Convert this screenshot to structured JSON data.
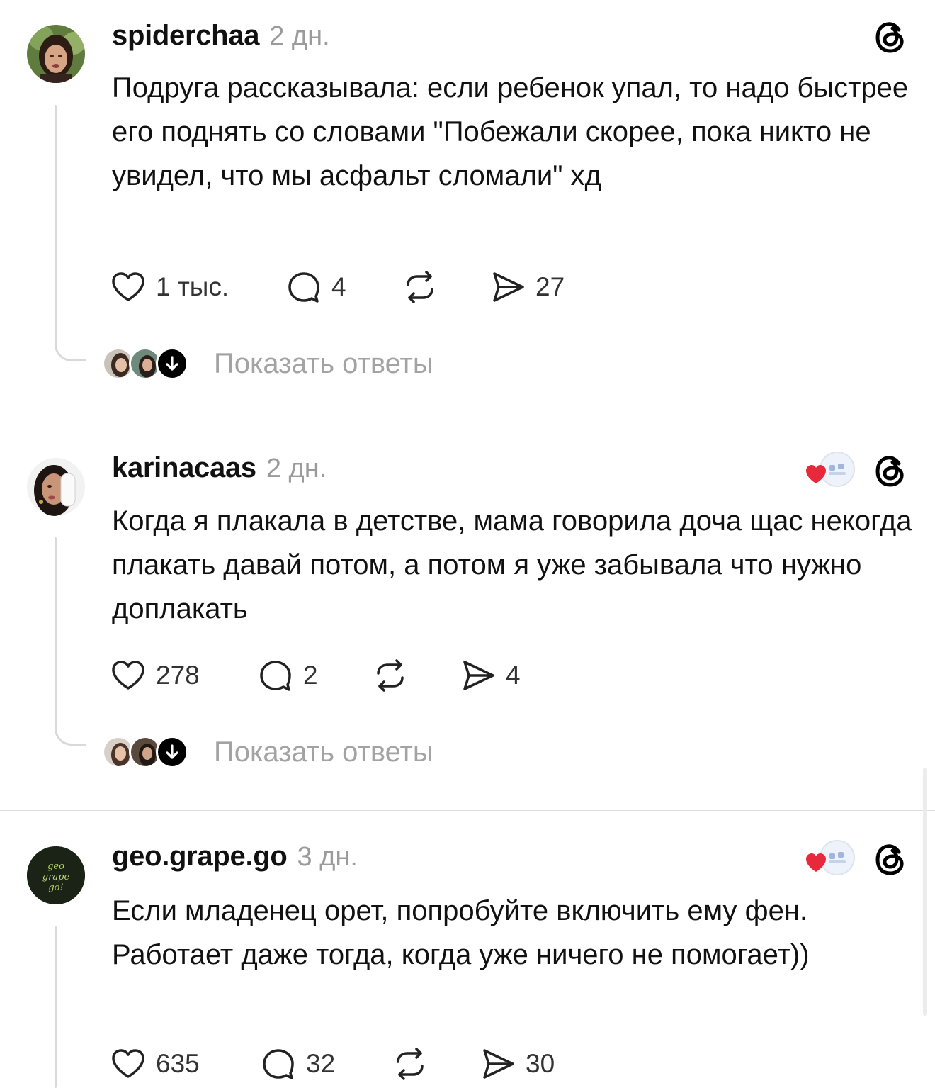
{
  "posts": [
    {
      "username": "spiderchaa",
      "time": "2 дн.",
      "text": "Подруга рассказывала: если ребенок упал, то надо быстрее его поднять со словами \"Побежали скорее, пока никто не увидел, что мы асфальт сломали\" хд",
      "likes": "1 тыс.",
      "comments": "4",
      "shares": "27",
      "show_replies": "Показать ответы",
      "has_reaction": false
    },
    {
      "username": "karinacaas",
      "time": "2 дн.",
      "text": "Когда я плакала в детстве, мама говорила доча щас некогда плакать давай потом, а потом я уже забывала что нужно доплакать",
      "likes": "278",
      "comments": "2",
      "shares": "4",
      "show_replies": "Показать ответы",
      "has_reaction": true
    },
    {
      "username": "geo.grape.go",
      "time": "3 дн.",
      "text": "Если младенец орет, попробуйте включить ему фен. Работает даже тогда, когда уже ничего не помогает))",
      "likes": "635",
      "comments": "32",
      "shares": "30",
      "has_reaction": true,
      "avatar_text": "geo grape go!"
    }
  ],
  "icons": {
    "like": "heart-icon",
    "comment": "comment-bubble-icon",
    "repost": "repost-icon",
    "share": "send-icon",
    "brand": "threads-logo-icon",
    "expand": "arrow-down-icon"
  },
  "colors": {
    "text": "#111111",
    "muted": "#9b9b9b",
    "reaction_heart": "#e8293b",
    "divider": "#dcdcdc"
  }
}
